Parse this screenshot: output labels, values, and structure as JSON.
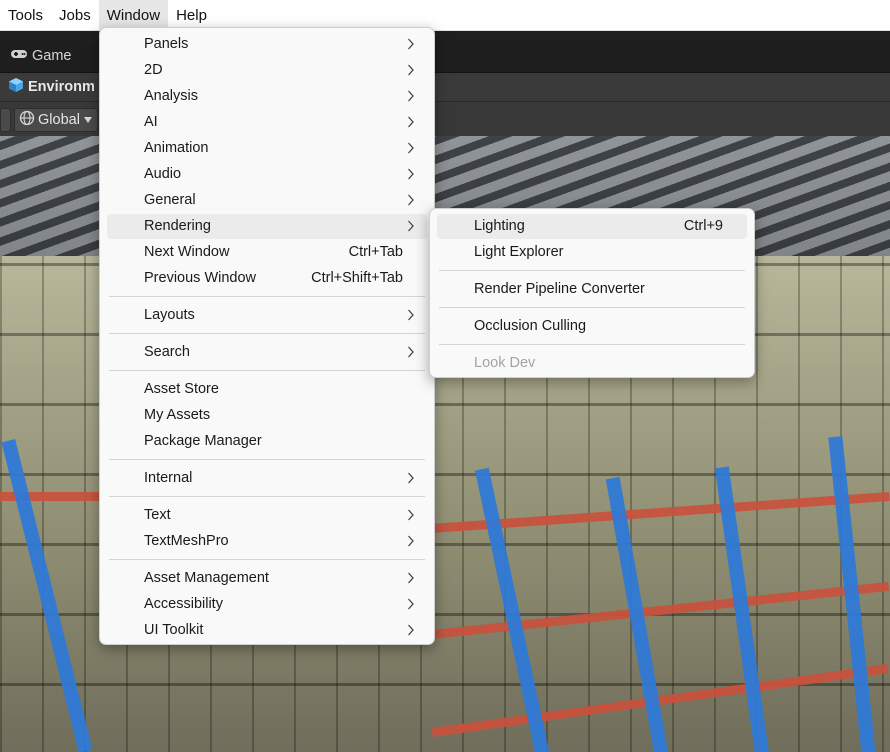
{
  "menubar": {
    "items": [
      "Tools",
      "Jobs",
      "Window",
      "Help"
    ]
  },
  "editor": {
    "game_tab": "Game",
    "scene_title": "Environm",
    "pivot_label": "Global"
  },
  "window_menu": {
    "items": [
      {
        "label": "Panels",
        "submenu": true
      },
      {
        "label": "2D",
        "submenu": true
      },
      {
        "label": "Analysis",
        "submenu": true
      },
      {
        "label": "AI",
        "submenu": true
      },
      {
        "label": "Animation",
        "submenu": true
      },
      {
        "label": "Audio",
        "submenu": true
      },
      {
        "label": "General",
        "submenu": true
      },
      {
        "label": "Rendering",
        "submenu": true
      },
      {
        "label": "Next Window",
        "shortcut": "Ctrl+Tab"
      },
      {
        "label": "Previous Window",
        "shortcut": "Ctrl+Shift+Tab"
      },
      {
        "label": "Layouts",
        "submenu": true
      },
      {
        "label": "Search",
        "submenu": true
      },
      {
        "label": "Asset Store"
      },
      {
        "label": "My Assets"
      },
      {
        "label": "Package Manager"
      },
      {
        "label": "Internal",
        "submenu": true
      },
      {
        "label": "Text",
        "submenu": true
      },
      {
        "label": "TextMeshPro",
        "submenu": true
      },
      {
        "label": "Asset Management",
        "submenu": true
      },
      {
        "label": "Accessibility",
        "submenu": true
      },
      {
        "label": "UI Toolkit",
        "submenu": true
      }
    ]
  },
  "rendering_submenu": {
    "items": [
      {
        "label": "Lighting",
        "shortcut": "Ctrl+9"
      },
      {
        "label": "Light Explorer"
      },
      {
        "label": "Render Pipeline Converter"
      },
      {
        "label": "Occlusion Culling"
      },
      {
        "label": "Look Dev",
        "disabled": true
      }
    ]
  },
  "icons": {
    "submenu_arrow": "chevron-right-icon",
    "game_tab": "gamepad-icon",
    "scene": "cube-icon",
    "pivot": "globe-icon"
  },
  "colors": {
    "menu_bg": "#f9f9f9",
    "highlight": "#ebebeb",
    "disabled_text": "#a3a3a3"
  }
}
